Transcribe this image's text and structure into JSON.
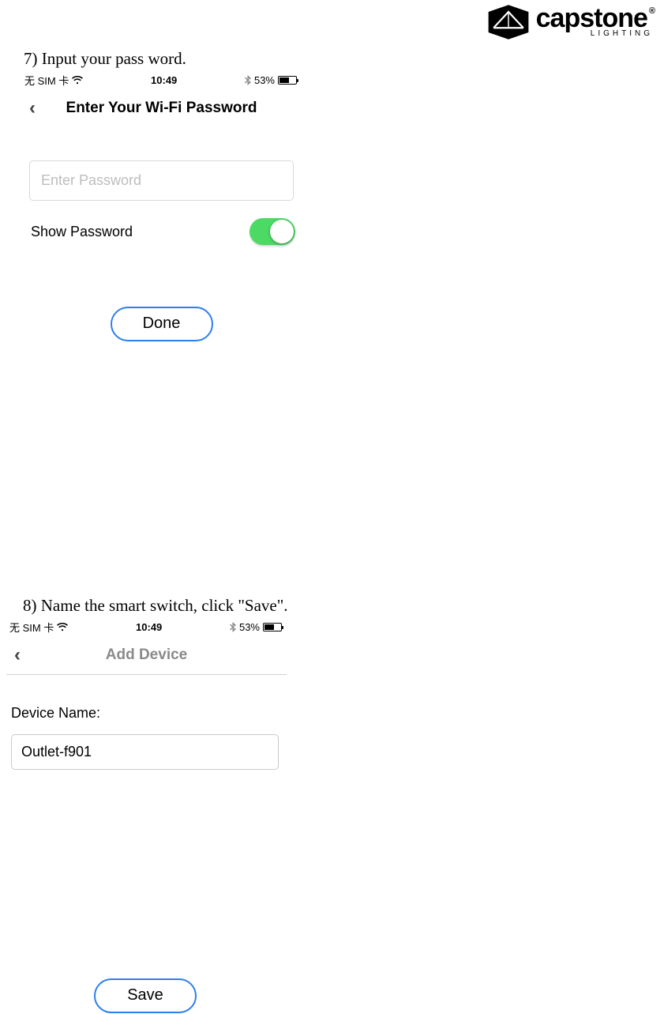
{
  "brand": {
    "word": "capstone",
    "reg": "®",
    "sub": "LIGHTING"
  },
  "step7": {
    "caption": "7)   Input your pass word.",
    "status": {
      "carrier": "无 SIM 卡",
      "time": "10:49",
      "battery": "53%"
    },
    "nav_title": "Enter Your Wi-Fi Password",
    "input_placeholder": "Enter Password",
    "show_label": "Show Password",
    "done": "Done"
  },
  "step8": {
    "caption": "8)   Name the smart switch, click \"Save\".",
    "status": {
      "carrier": "无 SIM 卡",
      "time": "10:49",
      "battery": "53%"
    },
    "nav_title": "Add Device",
    "field_label": "Device Name:",
    "device_value": "Outlet-f901",
    "save": "Save"
  }
}
